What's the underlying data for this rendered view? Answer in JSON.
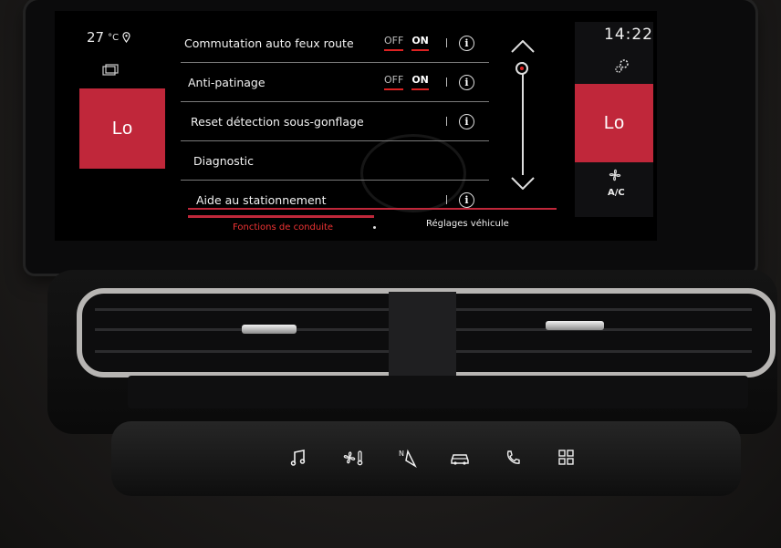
{
  "climate": {
    "outside_temp": "27",
    "outside_temp_unit": "°C",
    "left_temp": "Lo",
    "right_temp": "Lo",
    "ac_label": "A/C"
  },
  "clock": "14:22",
  "menu": {
    "items": [
      {
        "label": "Commutation auto feux route",
        "toggle_off": "OFF",
        "toggle_on": "ON",
        "info": "i"
      },
      {
        "label": "Anti-patinage",
        "toggle_off": "OFF",
        "toggle_on": "ON",
        "info": "i"
      },
      {
        "label": "Reset détection sous-gonflage",
        "info": "i"
      },
      {
        "label": "Diagnostic"
      },
      {
        "label": "Aide au stationnement",
        "info": "i"
      }
    ]
  },
  "tabs": [
    {
      "label": "Fonctions de conduite",
      "active": true
    },
    {
      "label": "Réglages véhicule",
      "active": false
    }
  ],
  "colors": {
    "accent": "#c0273a",
    "background": "#000000"
  },
  "icons": [
    "location-icon",
    "recirculation-icon",
    "settings-gear-icon",
    "fan-icon",
    "music-icon",
    "climate-fan-icon",
    "navigation-icon",
    "car-icon",
    "phone-icon",
    "apps-grid-icon"
  ]
}
